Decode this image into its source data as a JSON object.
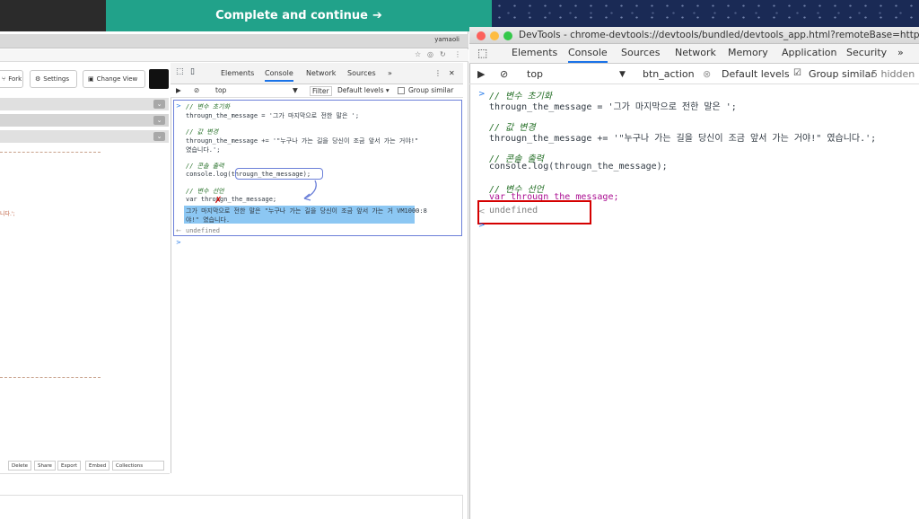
{
  "banner": {
    "continue_label": "Complete and continue",
    "continue_arrow": "➔"
  },
  "left_browser": {
    "user": "yamaoli",
    "toolbar": {
      "fork": "Fork",
      "settings": "Settings",
      "change_view": "Change View"
    },
    "editor_fragment": "니다.';",
    "bottom_buttons": [
      "Delete",
      "Share",
      "Export",
      "Embed",
      "Collections"
    ]
  },
  "small_devtools": {
    "tabs": [
      "Elements",
      "Console",
      "Network",
      "Sources",
      "»",
      "⋮",
      "✕"
    ],
    "active_tab": "Console",
    "context": "top",
    "filter": "Filter",
    "levels": "Default levels ▾",
    "group_similar": "Group similar",
    "lines": [
      "// 변수 초기화",
      "througn_the_message = '그가 마지막으로 전한 말은 ';",
      "// 값 변경",
      "througn_the_message += '\"누구나 가는 길을 당신이 조금 앞서 가는 거야!\"",
      "였습니다.';",
      "// 콘솔 출력",
      "console.log(througn_the_message);",
      "// 변수 선언",
      "var througn_the_message;",
      "그가 마지막으로 전한 말은 \"누구나 가는 길을 당신이 조금 앞서 가는 거 VM1000:8",
      "야!\" 였습니다.",
      "undefined"
    ]
  },
  "devtools_window": {
    "title": "DevTools - chrome-devtools://devtools/bundled/devtools_app.html?remoteBase=https://chrome",
    "tabs": [
      "Elements",
      "Console",
      "Sources",
      "Network",
      "Memory",
      "Application",
      "Security",
      "»"
    ],
    "active_tab": "Console",
    "context": "top",
    "filter_value": "btn_action",
    "levels": "Default levels",
    "group_similar": "Group similar",
    "hidden_count": "5 hidden",
    "lines": [
      "// 변수 초기화",
      "througn_the_message = '그가 마지막으로 전한 말은 ';",
      "// 값 변경",
      "througn_the_message += '\"누구나 가는 길을 당신이 조금 앞서 가는 거야!\" 였습니다.';",
      "// 콘솔 출력",
      "console.log(througn_the_message);",
      "// 변수 선언",
      "var througn_the_message;",
      "undefined"
    ]
  },
  "colors": {
    "teal": "#21a28a",
    "accent_blue": "#1a73e8",
    "highlight_red": "#d50000"
  }
}
